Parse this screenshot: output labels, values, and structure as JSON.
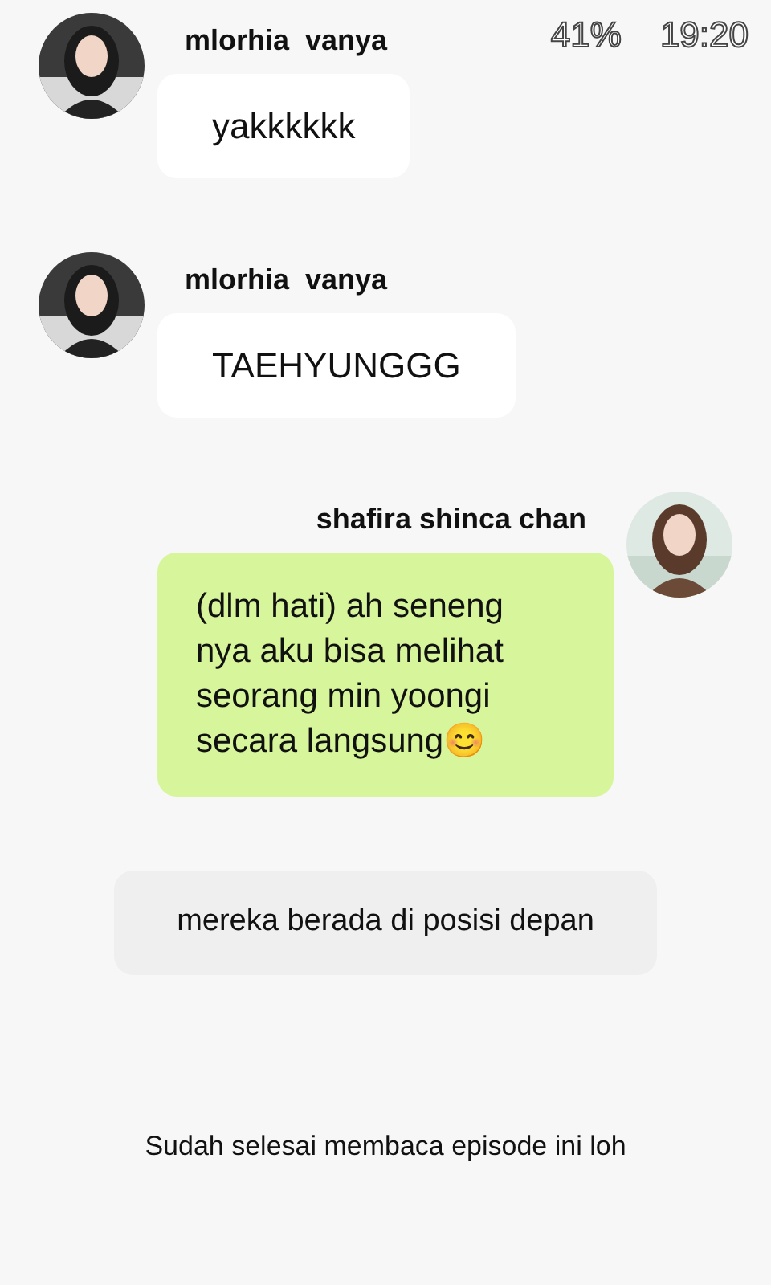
{
  "status_bar": {
    "battery": "41%",
    "time": "19:20"
  },
  "messages": [
    {
      "kind": "left",
      "sender": "mlorhia  vanya",
      "text": "yakkkkkk"
    },
    {
      "kind": "left",
      "sender": "mlorhia  vanya",
      "text": "TAEHYUNGGG"
    },
    {
      "kind": "right",
      "sender": "shafira shinca chan",
      "text": "(dlm hati) ah seneng nya aku bisa melihat seorang min yoongi secara langsung😊"
    },
    {
      "kind": "narration",
      "text": "mereka berada di posisi depan"
    }
  ],
  "footer": "Sudah selesai membaca episode ini loh"
}
